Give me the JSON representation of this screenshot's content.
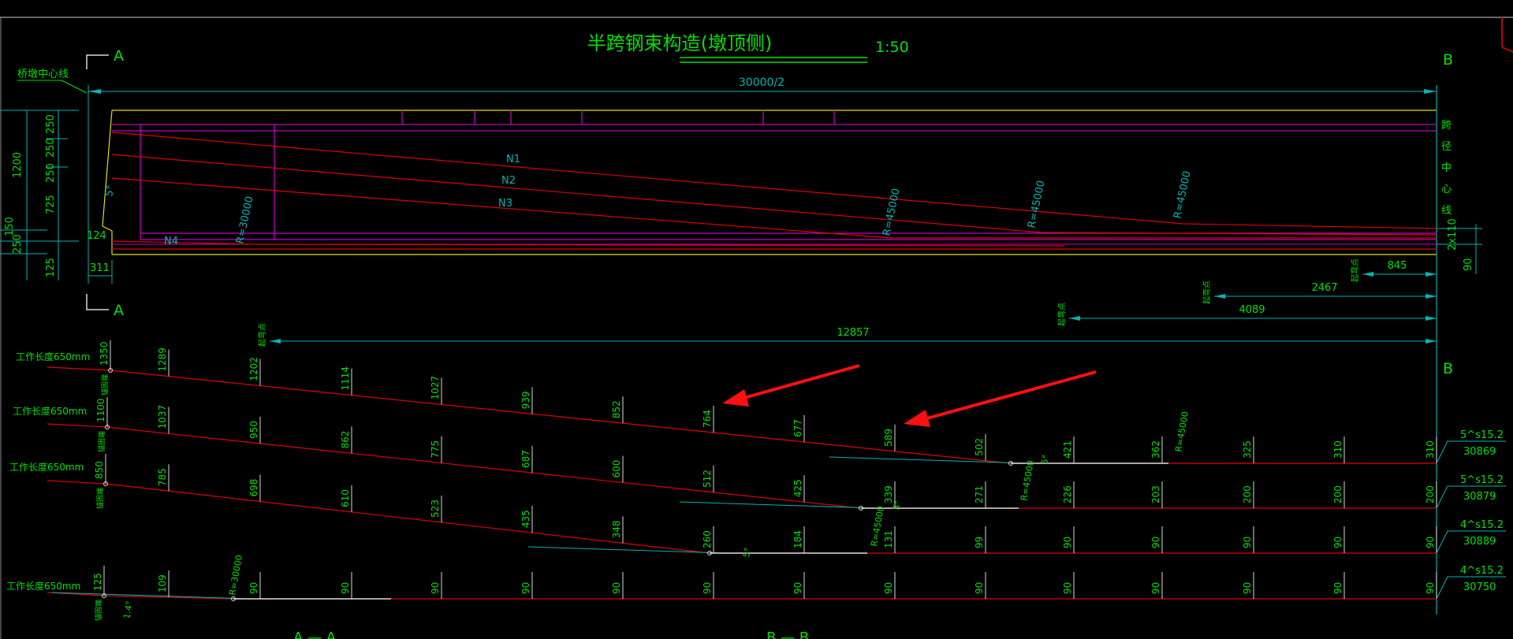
{
  "title": "半跨钢束构造(墩顶侧)",
  "title_scale": "1:50",
  "section_marks": {
    "a_top": "A",
    "a_bottom": "A",
    "b_top": "B",
    "b_mid": "B"
  },
  "pier_centerline": "桥墩中心线",
  "span_center_label": [
    "跨",
    "径",
    "中",
    "心",
    "线"
  ],
  "top_dim": "30000/2",
  "left_dims": {
    "d250a": "250",
    "d250b": "250",
    "d250c": "250",
    "d1200": "1200",
    "d725": "725",
    "d150": "150",
    "d250d": "250",
    "d125": "125",
    "d124": "124",
    "d311": "311"
  },
  "right_dims": {
    "d2x110": "2x110",
    "d90": "90"
  },
  "tendon_names": [
    "N1",
    "N2",
    "N3",
    "N4"
  ],
  "radii": {
    "r30000": "R=30000",
    "r45000": "R=45000"
  },
  "bend_angles": {
    "a5": "5°",
    "a14": "1.4°"
  },
  "qwd_label": "起弯点",
  "anchor_label": "锚固端",
  "bend_dims": [
    "845",
    "2467",
    "4089",
    "12857"
  ],
  "work_len_label": "工作长度650mm",
  "tendon_rows": [
    {
      "end": "1350",
      "vals": [
        "1289",
        "1202",
        "1114",
        "1027",
        "939",
        "852",
        "764",
        "677",
        "589",
        "502",
        "421",
        "362",
        "325",
        "310",
        "310"
      ],
      "spec": "5^s15.2",
      "len": "30869"
    },
    {
      "end": "1100",
      "vals": [
        "1037",
        "950",
        "862",
        "775",
        "687",
        "600",
        "512",
        "425",
        "339",
        "271",
        "226",
        "203",
        "200",
        "200",
        "200"
      ],
      "spec": "5^s15.2",
      "len": "30879"
    },
    {
      "end": "850",
      "vals": [
        "785",
        "698",
        "610",
        "523",
        "435",
        "348",
        "260",
        "184",
        "131",
        "99",
        "90",
        "90",
        "90",
        "90",
        "90"
      ],
      "spec": "4^s15.2",
      "len": "30889"
    },
    {
      "end": "125",
      "vals": [
        "109",
        "90",
        "90",
        "90",
        "90",
        "90",
        "90",
        "90",
        "90",
        "90",
        "90",
        "90",
        "90",
        "90",
        "90"
      ],
      "spec": "4^s15.2",
      "len": "30750"
    }
  ],
  "bottom_labels": {
    "aa": "A — A",
    "bb": "B — B"
  },
  "colors": {
    "bg": "#000000",
    "cyan": "#00b4b4",
    "green": "#00e000",
    "red": "#e00000",
    "magenta": "#c000c0",
    "yellow": "#e0e000",
    "white": "#d8d8d8",
    "arrow": "#ff1010"
  }
}
